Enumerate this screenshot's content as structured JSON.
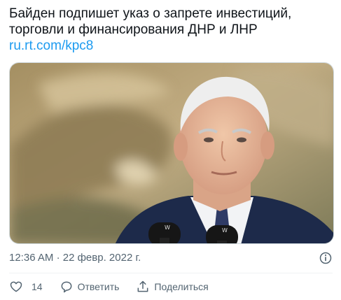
{
  "tweet": {
    "text_line1": "Байден подпишет указ о запрете инвестиций,",
    "text_line2": "торговли и финансирования ДНР и ЛНР",
    "link": "ru.rt.com/kpc8",
    "time": "12:36 AM",
    "separator": "·",
    "date": "22 февр. 2022 г."
  },
  "actions": {
    "like_count": "14",
    "reply_label": "Ответить",
    "share_label": "Поделиться"
  },
  "icons": {
    "like": "heart-icon",
    "reply": "speech-bubble-icon",
    "share": "upload-icon",
    "info": "info-icon"
  },
  "colors": {
    "link": "#1d9bf0",
    "secondary_text": "#536471",
    "primary_text": "#0f1419"
  }
}
